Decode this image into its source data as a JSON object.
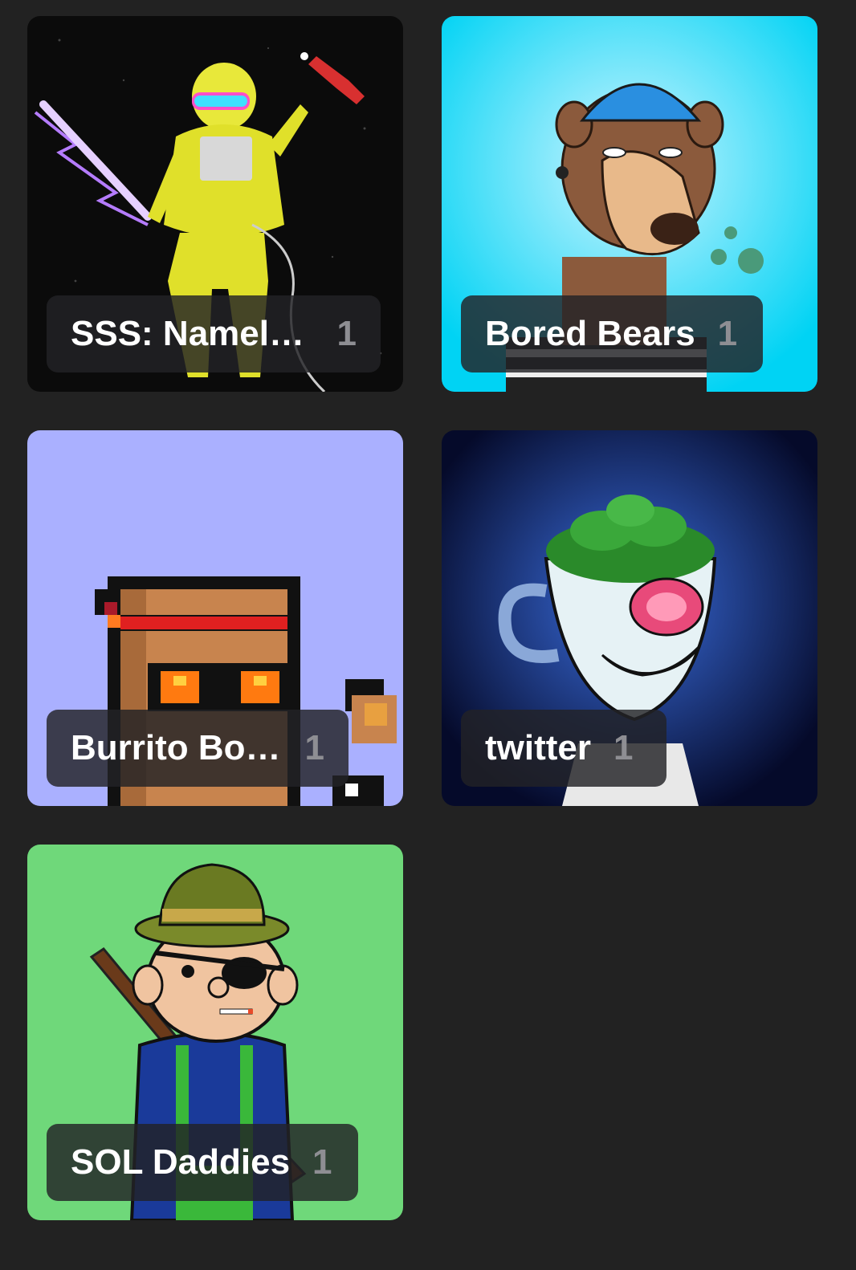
{
  "collections": [
    {
      "name": "SSS: Namele...",
      "count": "1",
      "bg": "#0b0b0b",
      "art": "astronaut-art"
    },
    {
      "name": "Bored Bears",
      "count": "1",
      "bg": "#00d3f4",
      "art": "bear-art"
    },
    {
      "name": "Burrito Boyz",
      "count": "1",
      "bg": "#aab0ff",
      "art": "pixel-character-art"
    },
    {
      "name": "twitter",
      "count": "1",
      "bg": "#0a1a66",
      "art": "stoner-cup-art"
    },
    {
      "name": "SOL Daddies",
      "count": "1",
      "bg": "#6fd87a",
      "art": "sol-daddy-art"
    }
  ]
}
